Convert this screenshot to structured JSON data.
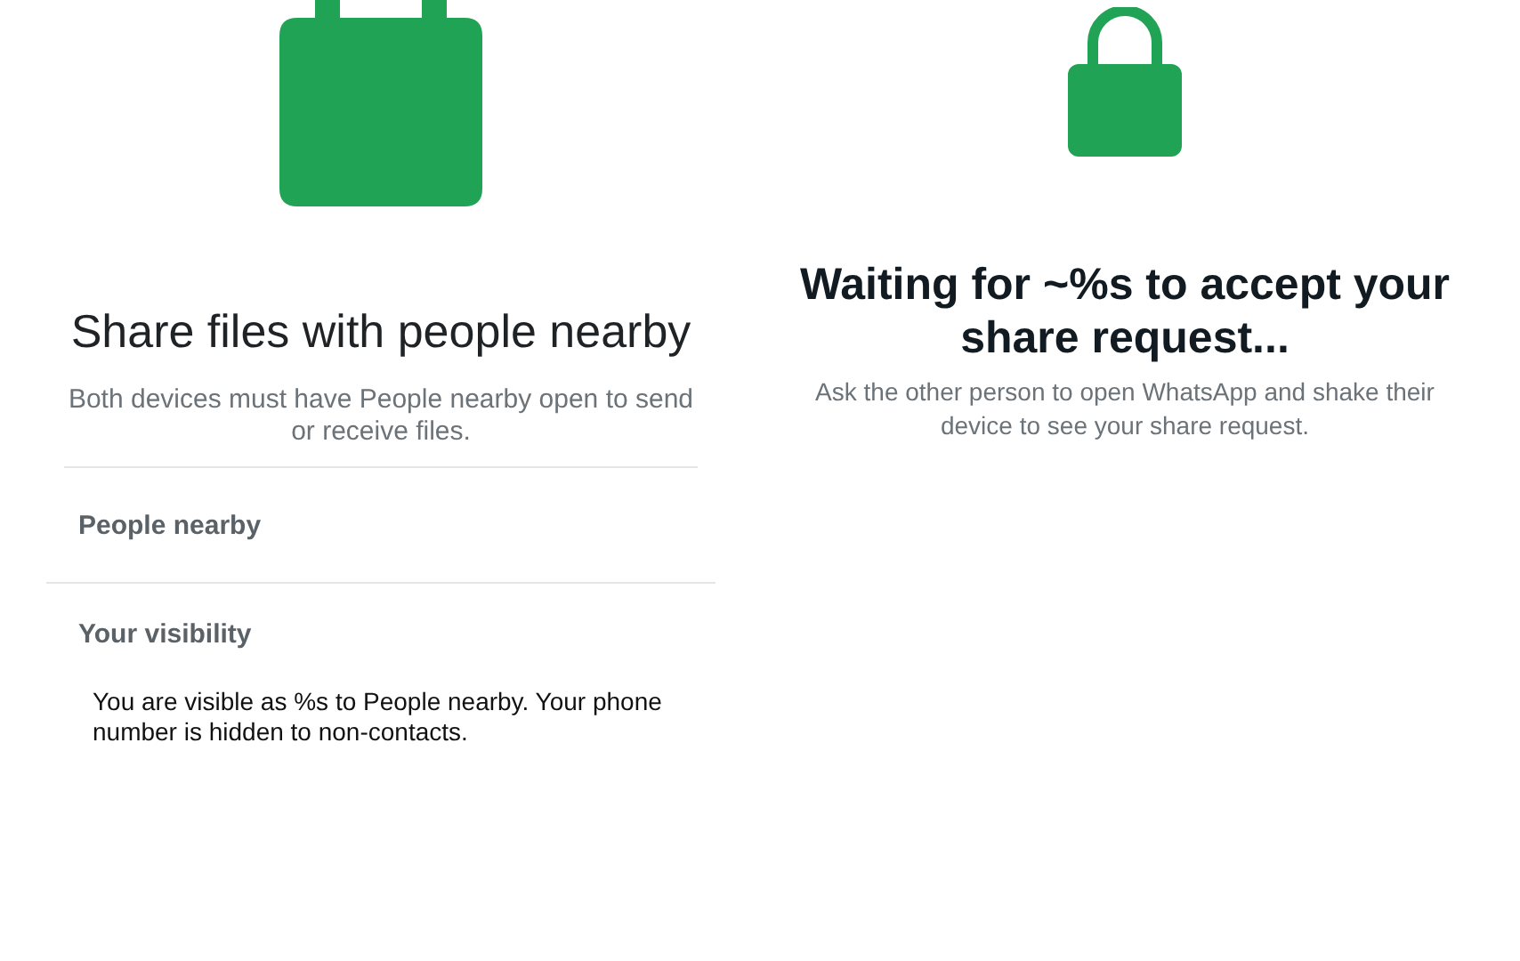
{
  "share_screen": {
    "title": "Share files with people nearby",
    "subtitle": "Both devices must have People nearby open to send or receive files.",
    "sections": [
      {
        "kind": "setting",
        "label": "People nearby"
      },
      {
        "kind": "info",
        "label": "Your visibility",
        "text": "You are visible as %s to People nearby. Your phone number is hidden to non-contacts."
      }
    ]
  },
  "waiting_screen": {
    "title": "Waiting for ~%s to accept your share request...",
    "subtitle": "Ask the other person to open WhatsApp and shake their device to see your share request."
  }
}
